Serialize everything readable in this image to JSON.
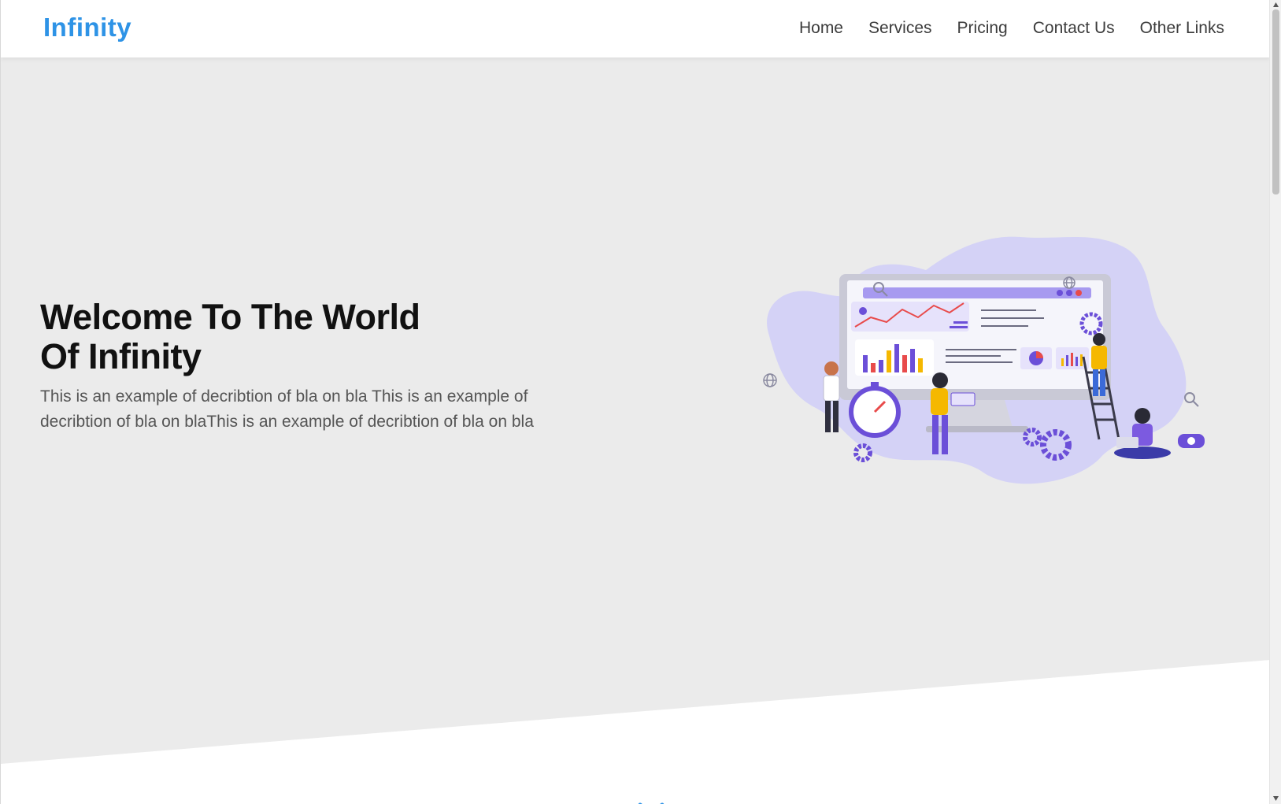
{
  "header": {
    "logo": "Infinity",
    "nav": [
      "Home",
      "Services",
      "Pricing",
      "Contact Us",
      "Other Links"
    ]
  },
  "hero": {
    "title_line1": "Welcome To The World",
    "title_line2": "Of Infinity",
    "description": "This is an example of decribtion of bla on bla This is an example of decribtion of bla on blaThis is an example of decribtion of bla on bla"
  },
  "colors": {
    "brand": "#2e93e6",
    "hero_bg": "#ebebeb",
    "accent_purple": "#6b4fd8",
    "accent_yellow": "#f5b800"
  },
  "icons": {
    "scroll_down": "double-chevron-down-icon"
  }
}
